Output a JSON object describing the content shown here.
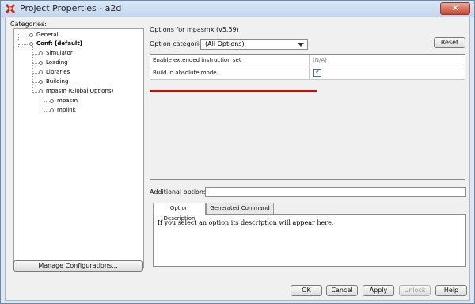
{
  "window": {
    "title": "Project Properties - a2d",
    "close_label": "✕"
  },
  "left": {
    "categories_label": "Categories:",
    "tree": [
      {
        "label": "General",
        "bold": false
      },
      {
        "label": "Conf: [default]",
        "bold": true
      },
      {
        "label": "Simulator",
        "bold": false
      },
      {
        "label": "Loading",
        "bold": false
      },
      {
        "label": "Libraries",
        "bold": false
      },
      {
        "label": "Building",
        "bold": false
      },
      {
        "label": "mpasm (Global Options)",
        "bold": false
      },
      {
        "label": "mpasm",
        "bold": false
      },
      {
        "label": "mplink",
        "bold": false
      }
    ],
    "manage_button": "Manage Configurations..."
  },
  "right": {
    "options_for": "Options for mpasmx (v5.59)",
    "option_categories_label": "Option categories:",
    "option_categories_value": "(All Options)",
    "reset_button": "Reset",
    "options": [
      {
        "name": "Enable extended instruction set",
        "value": "(N/A)"
      },
      {
        "name": "Build in absolute mode",
        "checked": true
      }
    ],
    "additional_options_label": "Additional options:",
    "additional_options_value": "",
    "tabs": [
      "Option Description",
      "Generated Command Line"
    ],
    "description": "If you select an option its description will appear here."
  },
  "footer": {
    "ok": "OK",
    "cancel": "Cancel",
    "apply": "Apply",
    "unlock": "Unlock",
    "help": "Help"
  },
  "colors": {
    "highlight_line": "#e20000",
    "title_gradient_top": "#d9e8f7",
    "title_gradient_bottom": "#c3d6ec"
  }
}
